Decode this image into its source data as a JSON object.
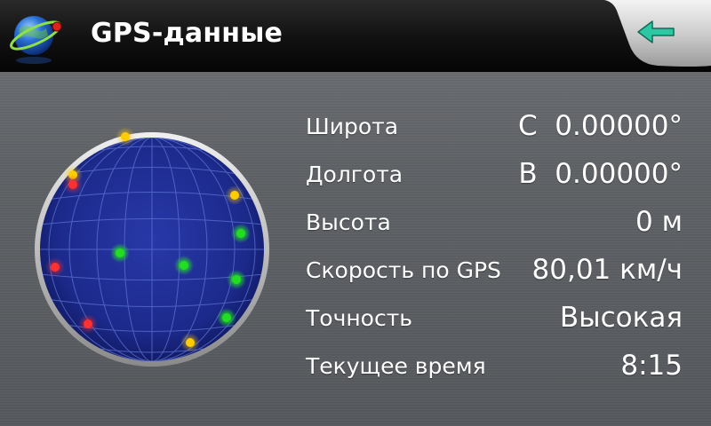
{
  "header": {
    "title": "GPS-данные",
    "logo_icon": "globe-satellite-icon",
    "back_icon": "back-arrow-icon",
    "back_arrow_color": "#2ec7a4"
  },
  "sky_view": {
    "globe_color": "#1c2a8c",
    "grid_color": "#5a6fd0",
    "status_colors": {
      "active": "#22dd22",
      "weak": "#ffcc00",
      "none": "#ff3030"
    },
    "satellites": [
      {
        "status": "weak",
        "color": "#ffcc00"
      },
      {
        "status": "weak",
        "color": "#ffcc00"
      },
      {
        "status": "none",
        "color": "#ff3030"
      },
      {
        "status": "weak",
        "color": "#ffcc00"
      },
      {
        "status": "active",
        "color": "#22dd22"
      },
      {
        "status": "active",
        "color": "#22dd22"
      },
      {
        "status": "active",
        "color": "#22dd22"
      },
      {
        "status": "none",
        "color": "#ff3030"
      },
      {
        "status": "active",
        "color": "#22dd22"
      },
      {
        "status": "active",
        "color": "#22dd22"
      },
      {
        "status": "none",
        "color": "#ff3030"
      },
      {
        "status": "weak",
        "color": "#ffcc00"
      }
    ]
  },
  "info": {
    "latitude": {
      "label": "Широта",
      "value": "С  0.00000°"
    },
    "longitude": {
      "label": "Долгота",
      "value": "В  0.00000°"
    },
    "altitude": {
      "label": "Высота",
      "value": "0 м"
    },
    "speed": {
      "label": "Скорость по GPS",
      "value": "80,01 км/ч"
    },
    "accuracy": {
      "label": "Точность",
      "value": "Высокая"
    },
    "time": {
      "label": "Текущее время",
      "value": "8:15"
    }
  }
}
